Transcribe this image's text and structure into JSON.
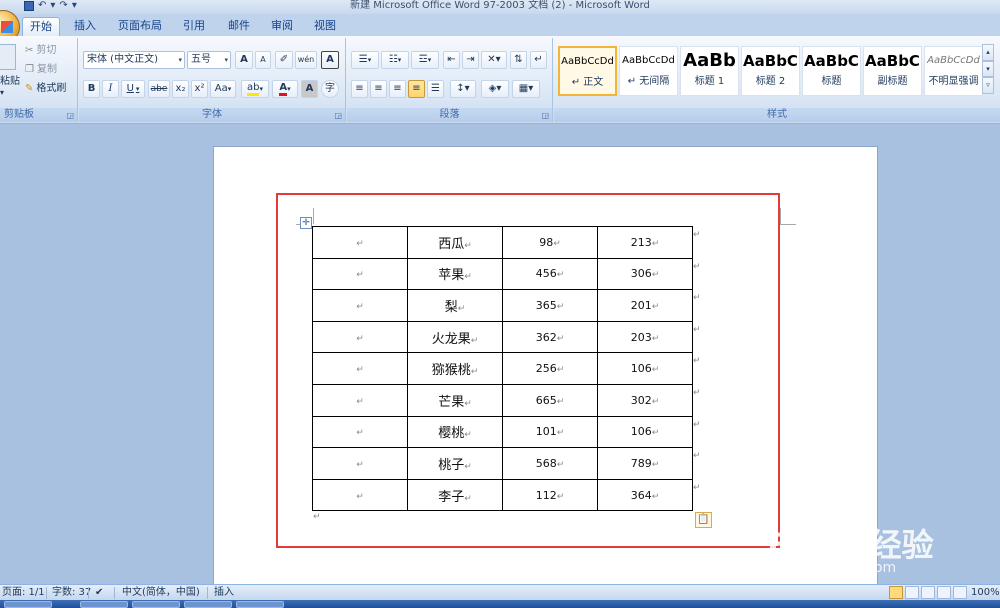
{
  "window": {
    "title": "新建 Microsoft Office Word 97-2003 文档 (2) - Microsoft Word"
  },
  "qat": {
    "save_icon": "save-icon",
    "undo": "↶",
    "redo": "↷"
  },
  "tabs": [
    "开始",
    "插入",
    "页面布局",
    "引用",
    "邮件",
    "审阅",
    "视图"
  ],
  "active_tab": "开始",
  "clipboard": {
    "paste_label": "粘贴",
    "cut_label": "剪切",
    "copy_label": "复制",
    "format_painter_label": "格式刷",
    "group_label": "剪贴板"
  },
  "font": {
    "font_name": "宋体 (中文正文)",
    "font_size": "五号",
    "grow": "A",
    "shrink": "A",
    "group_label": "字体",
    "bold": "B",
    "italic": "I",
    "underline": "U",
    "strike": "abe",
    "subscript": "x₂",
    "superscript": "x²",
    "change_case": "Aa",
    "highlight": "ab",
    "font_color": "A",
    "char_shading": "A",
    "enclose": "字"
  },
  "paragraph": {
    "group_label": "段落"
  },
  "styles": {
    "group_label": "样式",
    "items": [
      {
        "sample": "AaBbCcDd",
        "name": "↵ 正文"
      },
      {
        "sample": "AaBbCcDd",
        "name": "↵ 无间隔"
      },
      {
        "sample": "AaBb",
        "name": "标题 1"
      },
      {
        "sample": "AaBbC",
        "name": "标题 2"
      },
      {
        "sample": "AaBbC",
        "name": "标题"
      },
      {
        "sample": "AaBbC",
        "name": "副标题"
      },
      {
        "sample": "AaBbCcDd",
        "name": "不明显强调"
      }
    ]
  },
  "table": {
    "rows": [
      [
        "",
        "西瓜",
        "98",
        "213"
      ],
      [
        "",
        "苹果",
        "456",
        "306"
      ],
      [
        "",
        "梨",
        "365",
        "201"
      ],
      [
        "",
        "火龙果",
        "362",
        "203"
      ],
      [
        "",
        "猕猴桃",
        "256",
        "106"
      ],
      [
        "",
        "芒果",
        "665",
        "302"
      ],
      [
        "",
        "樱桃",
        "101",
        "106"
      ],
      [
        "",
        "桃子",
        "568",
        "789"
      ],
      [
        "",
        "李子",
        "112",
        "364"
      ]
    ],
    "cell_mark": "↵"
  },
  "status": {
    "page": "页面: 1/1",
    "word_count": "字数: 37",
    "language": "中文(简体，中国)",
    "mode": "插入",
    "zoom": "100%"
  },
  "watermark": {
    "brand": "Baidu经验",
    "url": "jingyan.baidu.com"
  },
  "colors": {
    "highlight_frame": "#e53a3a",
    "ribbon": "#dbe7f5",
    "accent": "#f2b637"
  }
}
